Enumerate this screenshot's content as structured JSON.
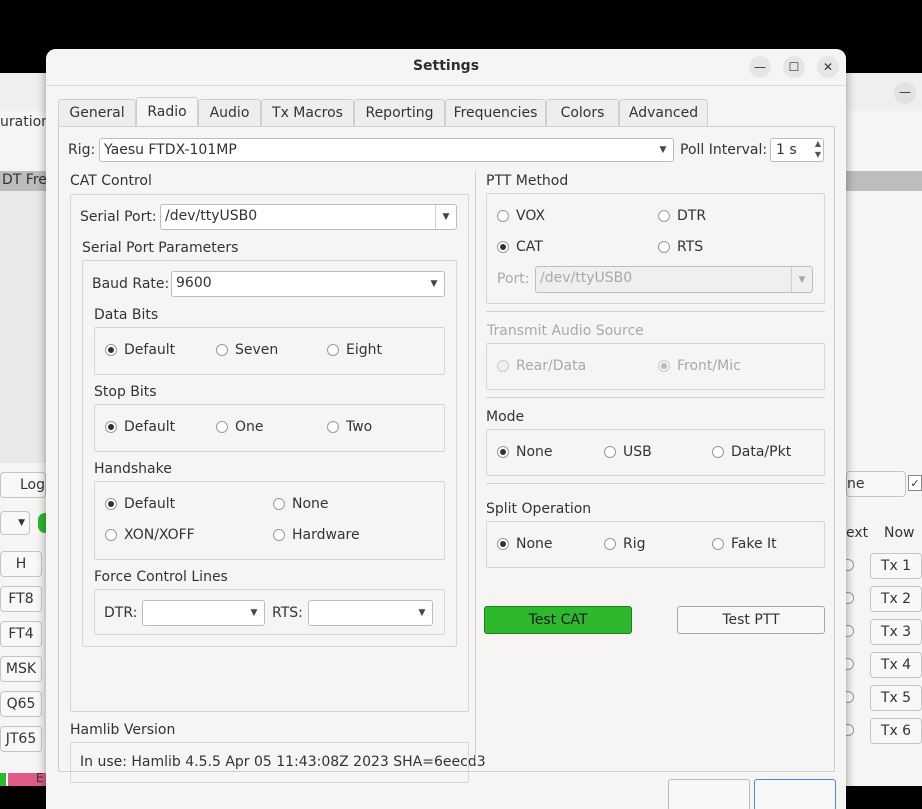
{
  "background_app": {
    "frag_urations": "urations",
    "frag_dt": "DT Fre",
    "log_button": "Log",
    "mode_buttons": [
      "H",
      "FT8",
      "FT4",
      "MSK",
      "Q65",
      "JT65"
    ],
    "next_label": "ext",
    "now_label": "Now",
    "tx_buttons": [
      "Tx 1",
      "Tx 2",
      "Tx 3",
      "Tx 4",
      "Tx 5",
      "Tx 6"
    ],
    "tune_fragment": "ne",
    "bottom_fragment": "E"
  },
  "window": {
    "title": "Settings"
  },
  "tabs": [
    "General",
    "Radio",
    "Audio",
    "Tx Macros",
    "Reporting",
    "Frequencies",
    "Colors",
    "Advanced"
  ],
  "active_tab": "Radio",
  "rig": {
    "label": "Rig:",
    "value": "Yaesu FTDX-101MP",
    "poll_label": "Poll Interval:",
    "poll_value": "1 s"
  },
  "cat": {
    "title": "CAT Control",
    "serial_port_label": "Serial Port:",
    "serial_port_value": "/dev/ttyUSB0",
    "params_title": "Serial Port Parameters",
    "baud_label": "Baud Rate:",
    "baud_value": "9600",
    "data_bits_title": "Data Bits",
    "data_bits": [
      "Default",
      "Seven",
      "Eight"
    ],
    "stop_bits_title": "Stop Bits",
    "stop_bits": [
      "Default",
      "One",
      "Two"
    ],
    "handshake_title": "Handshake",
    "handshake": [
      "Default",
      "None",
      "XON/XOFF",
      "Hardware"
    ],
    "force_title": "Force Control Lines",
    "dtr_label": "DTR:",
    "rts_label": "RTS:"
  },
  "hamlib": {
    "title": "Hamlib Version",
    "text": "In use:  Hamlib 4.5.5 Apr 05 11:43:08Z 2023 SHA=6eecd3"
  },
  "ptt": {
    "title": "PTT Method",
    "options": [
      "VOX",
      "DTR",
      "CAT",
      "RTS"
    ],
    "port_label": "Port:",
    "port_value": "/dev/ttyUSB0"
  },
  "audio_source": {
    "title": "Transmit Audio Source",
    "options": [
      "Rear/Data",
      "Front/Mic"
    ]
  },
  "mode": {
    "title": "Mode",
    "options": [
      "None",
      "USB",
      "Data/Pkt"
    ]
  },
  "split": {
    "title": "Split Operation",
    "options": [
      "None",
      "Rig",
      "Fake It"
    ]
  },
  "buttons": {
    "test_cat": "Test CAT",
    "test_ptt": "Test PTT"
  },
  "colors": {
    "accent_green": "#2eb82e",
    "background": "#f6f5f4"
  }
}
